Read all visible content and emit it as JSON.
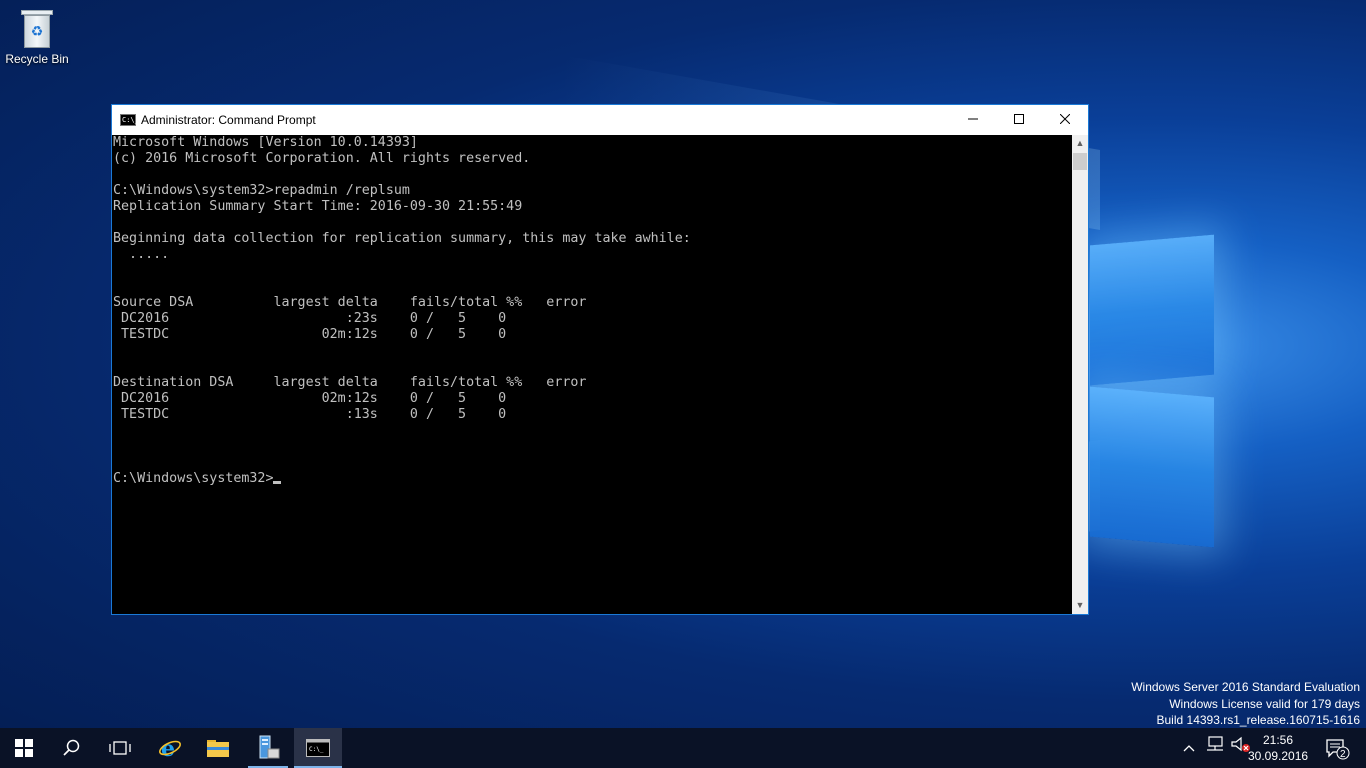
{
  "desktop": {
    "icons": [
      {
        "label": "Recycle Bin",
        "icon": "recycle-bin-icon"
      }
    ]
  },
  "window": {
    "title": "Administrator: Command Prompt",
    "controls": {
      "minimize": "—",
      "maximize": "☐",
      "close": "✕"
    },
    "console_lines": [
      "Microsoft Windows [Version 10.0.14393]",
      "(c) 2016 Microsoft Corporation. All rights reserved.",
      "",
      "C:\\Windows\\system32>repadmin /replsum",
      "Replication Summary Start Time: 2016-09-30 21:55:49",
      "",
      "Beginning data collection for replication summary, this may take awhile:",
      "  .....",
      "",
      "",
      "Source DSA          largest delta    fails/total %%   error",
      " DC2016                      :23s    0 /   5    0",
      " TESTDC                   02m:12s    0 /   5    0",
      "",
      "",
      "Destination DSA     largest delta    fails/total %%   error",
      " DC2016                   02m:12s    0 /   5    0",
      " TESTDC                      :13s    0 /   5    0",
      "",
      "",
      "",
      "C:\\Windows\\system32>"
    ]
  },
  "watermark": {
    "line1": "Windows Server 2016 Standard Evaluation",
    "line2": "Windows License valid for 179 days",
    "line3": "Build 14393.rs1_release.160715-1616"
  },
  "taskbar": {
    "buttons": [
      "start-icon",
      "search-icon",
      "task-view-icon",
      "internet-explorer-icon",
      "file-explorer-icon",
      "server-manager-icon",
      "command-prompt-icon"
    ],
    "clock": {
      "time": "21:56",
      "date": "30.09.2016"
    },
    "notification_count": "2"
  }
}
